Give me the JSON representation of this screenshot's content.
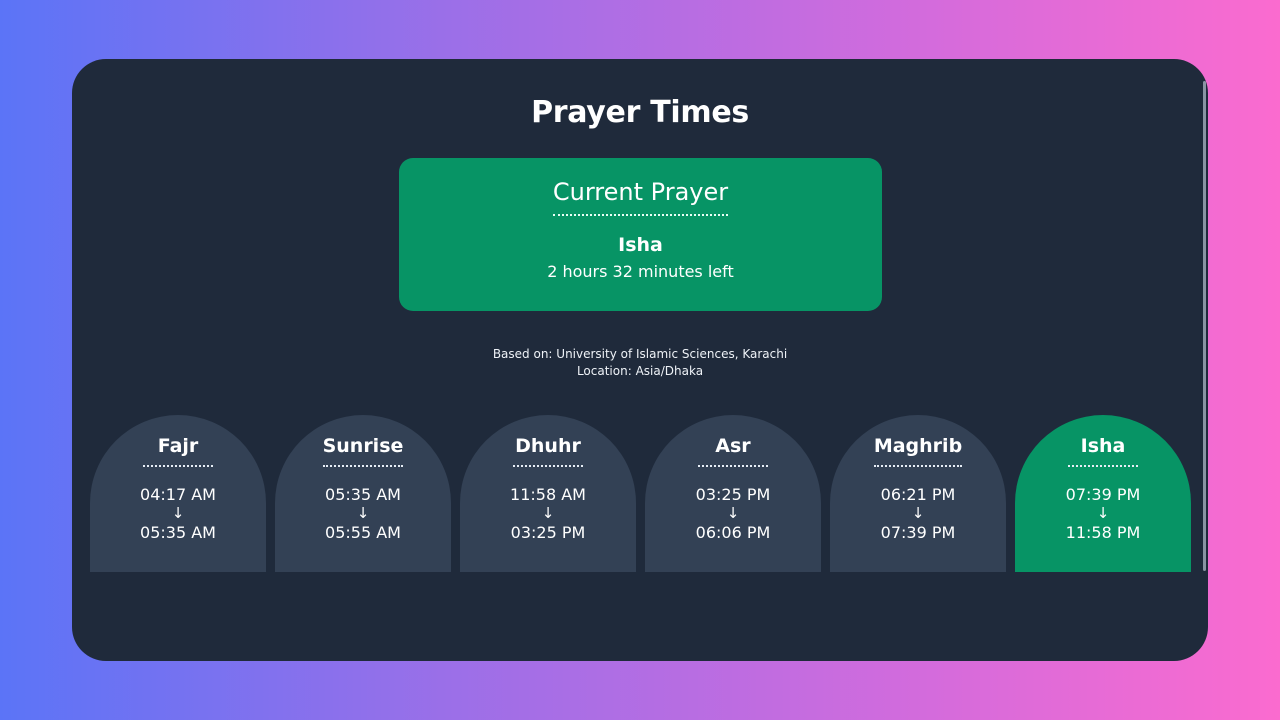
{
  "page": {
    "title": "Prayer Times"
  },
  "current": {
    "heading": "Current Prayer",
    "name": "Isha",
    "remaining": "2 hours 32 minutes left"
  },
  "meta": {
    "method": "Based on: University of Islamic Sciences, Karachi",
    "location": "Location: Asia/Dhaka"
  },
  "prayers": [
    {
      "name": "Fajr",
      "start": "04:17 AM",
      "arrow": "↓",
      "end": "05:35 AM",
      "active": false
    },
    {
      "name": "Sunrise",
      "start": "05:35 AM",
      "arrow": "↓",
      "end": "05:55 AM",
      "active": false
    },
    {
      "name": "Dhuhr",
      "start": "11:58 AM",
      "arrow": "↓",
      "end": "03:25 PM",
      "active": false
    },
    {
      "name": "Asr",
      "start": "03:25 PM",
      "arrow": "↓",
      "end": "06:06 PM",
      "active": false
    },
    {
      "name": "Maghrib",
      "start": "06:21 PM",
      "arrow": "↓",
      "end": "07:39 PM",
      "active": false
    },
    {
      "name": "Isha",
      "start": "07:39 PM",
      "arrow": "↓",
      "end": "11:58 PM",
      "active": true
    }
  ],
  "colors": {
    "panel": "#1f2a3b",
    "card": "#334155",
    "active": "#079465",
    "text": "#ffffff"
  }
}
